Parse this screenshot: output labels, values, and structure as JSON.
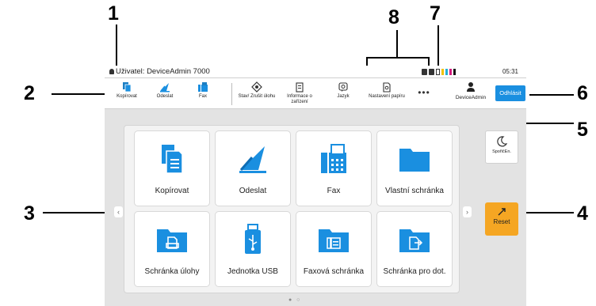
{
  "callouts": [
    "1",
    "2",
    "3",
    "4",
    "5",
    "6",
    "7",
    "8"
  ],
  "status_bar": {
    "user": "Uživatel: DeviceAdmin 7000",
    "time": "05:31"
  },
  "toolbar": {
    "items": [
      {
        "label": "Kopírovat",
        "icon": "copy-icon"
      },
      {
        "label": "Odeslat",
        "icon": "send-icon"
      },
      {
        "label": "Fax",
        "icon": "fax-icon"
      },
      {
        "label": "Stav/ Zrušit úlohu",
        "icon": "status-cancel-icon"
      },
      {
        "label": "Informace o zařízení",
        "icon": "device-info-icon"
      },
      {
        "label": "Jazyk",
        "icon": "language-icon"
      },
      {
        "label": "Nastavení papíru",
        "icon": "paper-settings-icon"
      }
    ],
    "more_label": "•••",
    "account_label": "DeviceAdmin",
    "logout_label": "Odhlásit"
  },
  "tiles": [
    {
      "label": "Kopírovat",
      "icon": "copy-icon"
    },
    {
      "label": "Odeslat",
      "icon": "send-icon"
    },
    {
      "label": "Fax",
      "icon": "fax-icon"
    },
    {
      "label": "Vlastní schránka",
      "icon": "folder-icon"
    },
    {
      "label": "Schránka úlohy",
      "icon": "job-box-icon"
    },
    {
      "label": "Jednotka USB",
      "icon": "usb-icon"
    },
    {
      "label": "Faxová schránka",
      "icon": "fax-box-icon"
    },
    {
      "label": "Schránka pro dot.",
      "icon": "polling-box-icon"
    }
  ],
  "side_buttons": {
    "sleep_label": "SpořičEn.",
    "reset_label": "Reset"
  },
  "page_indicator": "● ○",
  "colors": {
    "accent_blue": "#1a8fe0",
    "reset_orange": "#f5a623",
    "screen_bg": "#e3e3e3"
  }
}
